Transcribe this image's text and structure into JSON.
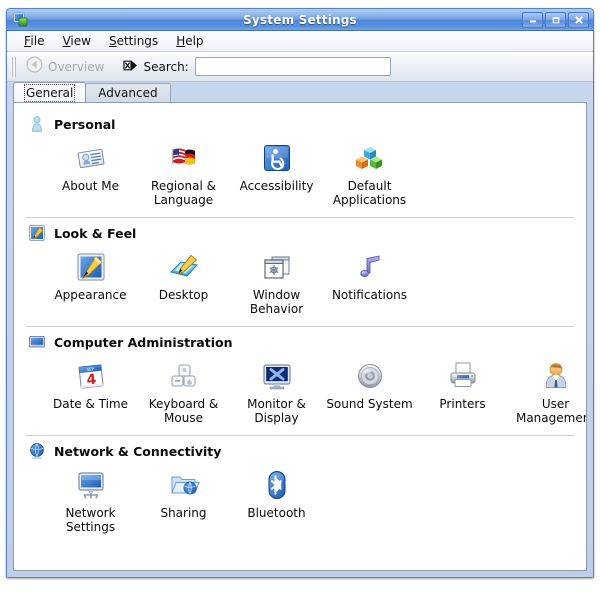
{
  "window": {
    "title": "System Settings",
    "app_icon": "system-settings-icon",
    "buttons": {
      "minimize": "minimize-button",
      "maximize": "maximize-button",
      "close": "close-button"
    }
  },
  "menubar": {
    "items": [
      {
        "label": "File",
        "accel": "F"
      },
      {
        "label": "View",
        "accel": "V"
      },
      {
        "label": "Settings",
        "accel": "S"
      },
      {
        "label": "Help",
        "accel": "H"
      }
    ]
  },
  "toolbar": {
    "overview_label": "Overview",
    "overview_icon": "back-arrow-icon",
    "search_icon": "clear-search-icon",
    "search_label": "Search:",
    "search_value": "",
    "search_placeholder": ""
  },
  "tabs": [
    {
      "label": "General",
      "active": true
    },
    {
      "label": "Advanced",
      "active": false
    }
  ],
  "sections": [
    {
      "title": "Personal",
      "icon": "person-bust-icon",
      "items": [
        {
          "label": "About Me",
          "icon": "id-card-icon"
        },
        {
          "label": "Regional & Language",
          "icon": "flags-icon"
        },
        {
          "label": "Accessibility",
          "icon": "wheelchair-icon"
        },
        {
          "label": "Default Applications",
          "icon": "cubes-icon"
        }
      ]
    },
    {
      "title": "Look & Feel",
      "icon": "appearance-brush-icon",
      "items": [
        {
          "label": "Appearance",
          "icon": "appearance-brush-icon"
        },
        {
          "label": "Desktop",
          "icon": "desktop-pencil-icon"
        },
        {
          "label": "Window Behavior",
          "icon": "windows-stack-icon"
        },
        {
          "label": "Notifications",
          "icon": "music-note-icon"
        }
      ]
    },
    {
      "title": "Computer Administration",
      "icon": "monitor-icon",
      "items": [
        {
          "label": "Date & Time",
          "icon": "calendar-icon"
        },
        {
          "label": "Keyboard & Mouse",
          "icon": "keyboard-mouse-icon"
        },
        {
          "label": "Monitor & Display",
          "icon": "display-x-icon"
        },
        {
          "label": "Sound System",
          "icon": "speaker-icon"
        },
        {
          "label": "Printers",
          "icon": "printer-icon"
        },
        {
          "label": "User Management",
          "icon": "user-icon"
        }
      ]
    },
    {
      "title": "Network & Connectivity",
      "icon": "globe-icon",
      "items": [
        {
          "label": "Network Settings",
          "icon": "network-monitor-icon"
        },
        {
          "label": "Sharing",
          "icon": "shared-folder-icon"
        },
        {
          "label": "Bluetooth",
          "icon": "bluetooth-icon"
        }
      ]
    }
  ],
  "colors": {
    "titlebar_blue": "#4d86da",
    "accent": "#3f6dbb",
    "window_bg": "#c8d6ee",
    "content_bg": "#ffffff"
  }
}
